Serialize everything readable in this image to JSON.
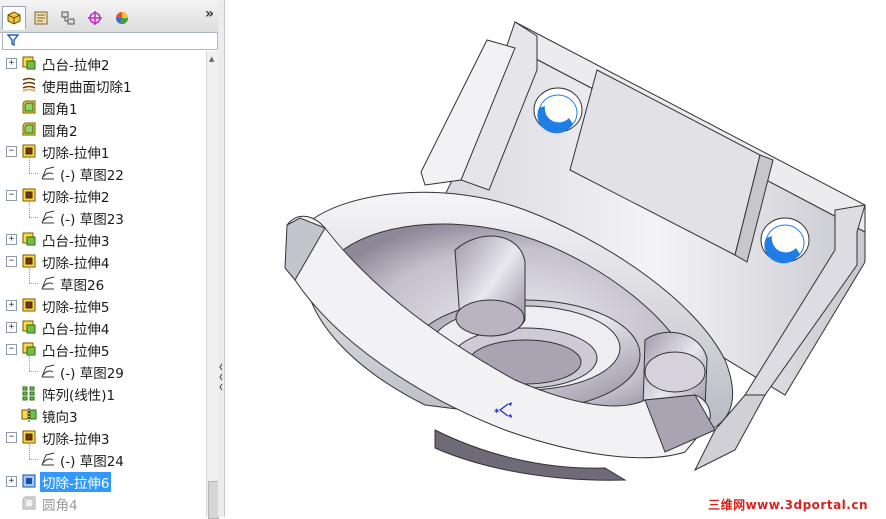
{
  "tabs": [
    {
      "name": "feature-manager-tab-icon"
    },
    {
      "name": "property-manager-tab-icon"
    },
    {
      "name": "configuration-manager-tab-icon"
    },
    {
      "name": "dimxpert-manager-tab-icon"
    },
    {
      "name": "display-manager-tab-icon"
    }
  ],
  "more_label": "»",
  "tree": [
    {
      "label": "凸台-拉伸2",
      "icon": "boss-extrude",
      "expandable": true
    },
    {
      "label": "使用曲面切除1",
      "icon": "surface-cut",
      "expandable": false
    },
    {
      "label": "圆角1",
      "icon": "fillet",
      "expandable": false
    },
    {
      "label": "圆角2",
      "icon": "fillet",
      "expandable": false
    },
    {
      "label": "切除-拉伸1",
      "icon": "cut-extrude",
      "expandable": true,
      "expanded": true
    },
    {
      "label": "(-) 草图22",
      "icon": "sketch",
      "child": true
    },
    {
      "label": "切除-拉伸2",
      "icon": "cut-extrude",
      "expandable": true,
      "expanded": true
    },
    {
      "label": "(-) 草图23",
      "icon": "sketch",
      "child": true
    },
    {
      "label": "凸台-拉伸3",
      "icon": "boss-extrude",
      "expandable": true
    },
    {
      "label": "切除-拉伸4",
      "icon": "cut-extrude",
      "expandable": true,
      "expanded": true
    },
    {
      "label": "草图26",
      "icon": "sketch",
      "child": true
    },
    {
      "label": "切除-拉伸5",
      "icon": "cut-extrude",
      "expandable": true
    },
    {
      "label": "凸台-拉伸4",
      "icon": "boss-extrude",
      "expandable": true
    },
    {
      "label": "凸台-拉伸5",
      "icon": "boss-extrude",
      "expandable": true,
      "expanded": true
    },
    {
      "label": "(-) 草图29",
      "icon": "sketch",
      "child": true
    },
    {
      "label": "阵列(线性)1",
      "icon": "linear-pattern",
      "expandable": false
    },
    {
      "label": "镜向3",
      "icon": "mirror",
      "expandable": false
    },
    {
      "label": "切除-拉伸3",
      "icon": "cut-extrude",
      "expandable": true,
      "expanded": true
    },
    {
      "label": "(-) 草图24",
      "icon": "sketch",
      "child": true
    },
    {
      "label": "切除-拉伸6",
      "icon": "cut-extrude-selected",
      "expandable": true,
      "selected": true
    },
    {
      "label": "圆角4",
      "icon": "fillet-suppressed",
      "expandable": false,
      "suppressed": true
    }
  ],
  "watermark": "三维网www.3dportal.cn",
  "colors": {
    "selection": "#3399ff",
    "watermark": "#d8241c",
    "hole_blue": "#1e7ee6"
  }
}
